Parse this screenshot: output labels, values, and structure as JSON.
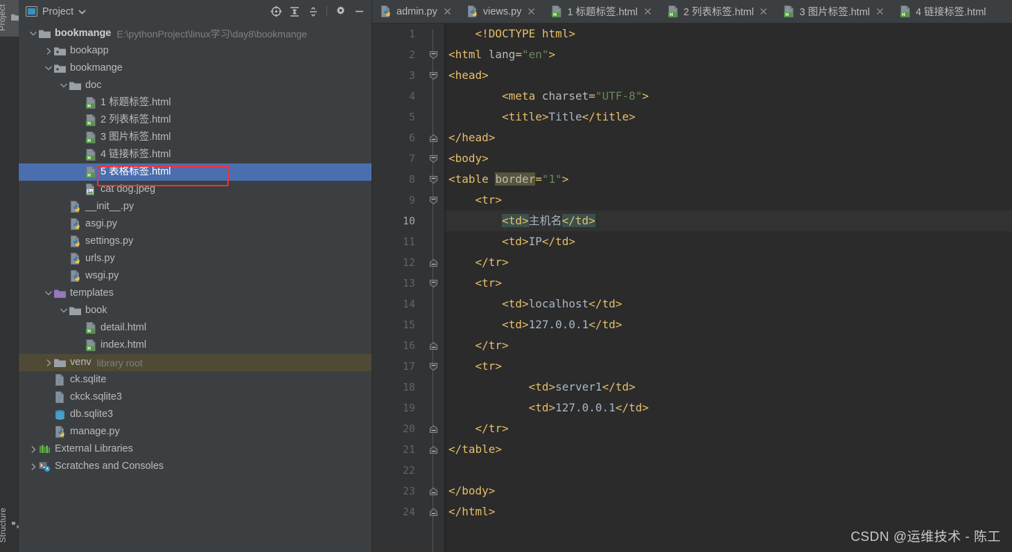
{
  "rail": {
    "top": {
      "label": "Project",
      "icon": "folder-icon",
      "active": true
    },
    "bottom": {
      "label": "Structure",
      "icon": "structure-icon",
      "active": false
    }
  },
  "project_panel": {
    "title": "Project",
    "dropdown_icon": "chevron-down-icon",
    "toolbar": [
      {
        "name": "select-opened-file-icon",
        "tooltip": "Select Opened File"
      },
      {
        "name": "expand-all-icon",
        "tooltip": "Expand All"
      },
      {
        "name": "collapse-all-icon",
        "tooltip": "Collapse All"
      },
      {
        "name": "settings-gear-icon",
        "tooltip": "Settings"
      },
      {
        "name": "hide-icon",
        "tooltip": "Hide"
      }
    ],
    "tree": [
      {
        "indent": 0,
        "arrow": "down",
        "icon": "folder-icon",
        "label": "bookmange",
        "bold": true,
        "path": "E:\\pythonProject\\linux学习\\day8\\bookmange",
        "state": "normal"
      },
      {
        "indent": 1,
        "arrow": "right",
        "icon": "module-folder-icon",
        "label": "bookapp",
        "bold": false,
        "state": "normal"
      },
      {
        "indent": 1,
        "arrow": "down",
        "icon": "module-folder-icon",
        "label": "bookmange",
        "bold": false,
        "state": "normal"
      },
      {
        "indent": 2,
        "arrow": "down",
        "icon": "folder-icon",
        "label": "doc",
        "bold": false,
        "state": "normal"
      },
      {
        "indent": 3,
        "arrow": "none",
        "icon": "html-file-icon",
        "label": "1 标题标签.html",
        "bold": false,
        "state": "normal"
      },
      {
        "indent": 3,
        "arrow": "none",
        "icon": "html-file-icon",
        "label": "2 列表标签.html",
        "bold": false,
        "state": "normal"
      },
      {
        "indent": 3,
        "arrow": "none",
        "icon": "html-file-icon",
        "label": "3 图片标签.html",
        "bold": false,
        "state": "normal"
      },
      {
        "indent": 3,
        "arrow": "none",
        "icon": "html-file-icon",
        "label": "4 链接标签.html",
        "bold": false,
        "state": "normal"
      },
      {
        "indent": 3,
        "arrow": "none",
        "icon": "html-file-icon",
        "label": "5 表格标签.html",
        "bold": false,
        "state": "selected"
      },
      {
        "indent": 3,
        "arrow": "none",
        "icon": "image-file-icon",
        "label": "cat dog.jpeg",
        "bold": false,
        "state": "normal"
      },
      {
        "indent": 2,
        "arrow": "none",
        "icon": "python-file-icon",
        "label": "__init__.py",
        "bold": false,
        "state": "normal"
      },
      {
        "indent": 2,
        "arrow": "none",
        "icon": "python-file-icon",
        "label": "asgi.py",
        "bold": false,
        "state": "normal"
      },
      {
        "indent": 2,
        "arrow": "none",
        "icon": "python-file-icon",
        "label": "settings.py",
        "bold": false,
        "state": "normal"
      },
      {
        "indent": 2,
        "arrow": "none",
        "icon": "python-file-icon",
        "label": "urls.py",
        "bold": false,
        "state": "normal"
      },
      {
        "indent": 2,
        "arrow": "none",
        "icon": "python-file-icon",
        "label": "wsgi.py",
        "bold": false,
        "state": "normal"
      },
      {
        "indent": 1,
        "arrow": "down",
        "icon": "templates-folder-icon",
        "label": "templates",
        "bold": false,
        "state": "normal"
      },
      {
        "indent": 2,
        "arrow": "down",
        "icon": "folder-icon",
        "label": "book",
        "bold": false,
        "state": "normal"
      },
      {
        "indent": 3,
        "arrow": "none",
        "icon": "html-file-icon",
        "label": "detail.html",
        "bold": false,
        "state": "normal"
      },
      {
        "indent": 3,
        "arrow": "none",
        "icon": "html-file-icon",
        "label": "index.html",
        "bold": false,
        "state": "normal"
      },
      {
        "indent": 1,
        "arrow": "right",
        "icon": "folder-icon",
        "label": "venv",
        "bold": false,
        "hint": "library root",
        "state": "hover"
      },
      {
        "indent": 1,
        "arrow": "none",
        "icon": "unknown-file-icon",
        "label": "ck.sqlite",
        "bold": false,
        "state": "normal"
      },
      {
        "indent": 1,
        "arrow": "none",
        "icon": "unknown-file-icon",
        "label": "ckck.sqlite3",
        "bold": false,
        "state": "normal"
      },
      {
        "indent": 1,
        "arrow": "none",
        "icon": "database-icon",
        "label": "db.sqlite3",
        "bold": false,
        "state": "normal"
      },
      {
        "indent": 1,
        "arrow": "none",
        "icon": "python-file-icon",
        "label": "manage.py",
        "bold": false,
        "state": "normal"
      },
      {
        "indent": 0,
        "arrow": "right",
        "icon": "external-libraries-icon",
        "label": "External Libraries",
        "bold": false,
        "state": "normal"
      },
      {
        "indent": 0,
        "arrow": "right",
        "icon": "scratches-icon",
        "label": "Scratches and Consoles",
        "bold": false,
        "state": "normal"
      }
    ]
  },
  "editor": {
    "tabs": [
      {
        "label": "admin.py",
        "icon": "python-file-icon",
        "closable": true,
        "active": false
      },
      {
        "label": "views.py",
        "icon": "python-file-icon",
        "closable": true,
        "active": false
      },
      {
        "label": "1 标题标签.html",
        "icon": "html-file-icon",
        "closable": true,
        "active": false
      },
      {
        "label": "2 列表标签.html",
        "icon": "html-file-icon",
        "closable": true,
        "active": false
      },
      {
        "label": "3 图片标签.html",
        "icon": "html-file-icon",
        "closable": true,
        "active": false
      },
      {
        "label": "4 链接标签.html",
        "icon": "html-file-icon",
        "closable": false,
        "active": false
      }
    ],
    "current_line": 10,
    "lines": [
      {
        "n": 1,
        "fold": "none",
        "indent": 1,
        "tokens": [
          {
            "t": "tag",
            "v": "<!DOCTYPE html>"
          }
        ]
      },
      {
        "n": 2,
        "fold": "open",
        "indent": 0,
        "tokens": [
          {
            "t": "tag",
            "v": "<html "
          },
          {
            "t": "attrname",
            "v": "lang"
          },
          {
            "t": "tag",
            "v": "="
          },
          {
            "t": "str",
            "v": "\"en\""
          },
          {
            "t": "tag",
            "v": ">"
          }
        ]
      },
      {
        "n": 3,
        "fold": "open",
        "indent": 0,
        "tokens": [
          {
            "t": "tag",
            "v": "<head>"
          }
        ]
      },
      {
        "n": 4,
        "fold": "none",
        "indent": 2,
        "tokens": [
          {
            "t": "tag",
            "v": "<meta "
          },
          {
            "t": "attrname",
            "v": "charset"
          },
          {
            "t": "tag",
            "v": "="
          },
          {
            "t": "str",
            "v": "\"UTF-8\""
          },
          {
            "t": "tag",
            "v": ">"
          }
        ]
      },
      {
        "n": 5,
        "fold": "none",
        "indent": 2,
        "tokens": [
          {
            "t": "tag",
            "v": "<title>"
          },
          {
            "t": "txt",
            "v": "Title"
          },
          {
            "t": "tag",
            "v": "</title>"
          }
        ]
      },
      {
        "n": 6,
        "fold": "close",
        "indent": 0,
        "tokens": [
          {
            "t": "tag",
            "v": "</head>"
          }
        ]
      },
      {
        "n": 7,
        "fold": "open",
        "indent": 0,
        "tokens": [
          {
            "t": "tag",
            "v": "<body>"
          }
        ]
      },
      {
        "n": 8,
        "fold": "open",
        "indent": 0,
        "tokens": [
          {
            "t": "tag",
            "v": "<table "
          },
          {
            "t": "attrname-hl",
            "v": "border"
          },
          {
            "t": "tag",
            "v": "="
          },
          {
            "t": "str",
            "v": "\"1\""
          },
          {
            "t": "tag",
            "v": ">"
          }
        ]
      },
      {
        "n": 9,
        "fold": "open",
        "indent": 1,
        "tokens": [
          {
            "t": "tag",
            "v": "<tr>"
          }
        ]
      },
      {
        "n": 10,
        "fold": "none",
        "indent": 2,
        "tokens": [
          {
            "t": "tag-hl",
            "v": "<td>"
          },
          {
            "t": "txt",
            "v": "主机名"
          },
          {
            "t": "tag-hl",
            "v": "</td>"
          }
        ]
      },
      {
        "n": 11,
        "fold": "none",
        "indent": 2,
        "tokens": [
          {
            "t": "tag",
            "v": "<td>"
          },
          {
            "t": "txt",
            "v": "IP"
          },
          {
            "t": "tag",
            "v": "</td>"
          }
        ]
      },
      {
        "n": 12,
        "fold": "close",
        "indent": 1,
        "tokens": [
          {
            "t": "tag",
            "v": "</tr>"
          }
        ]
      },
      {
        "n": 13,
        "fold": "open",
        "indent": 1,
        "tokens": [
          {
            "t": "tag",
            "v": "<tr>"
          }
        ]
      },
      {
        "n": 14,
        "fold": "none",
        "indent": 2,
        "tokens": [
          {
            "t": "tag",
            "v": "<td>"
          },
          {
            "t": "txt",
            "v": "localhost"
          },
          {
            "t": "tag",
            "v": "</td>"
          }
        ]
      },
      {
        "n": 15,
        "fold": "none",
        "indent": 2,
        "tokens": [
          {
            "t": "tag",
            "v": "<td>"
          },
          {
            "t": "txt",
            "v": "127.0.0.1"
          },
          {
            "t": "tag",
            "v": "</td>"
          }
        ]
      },
      {
        "n": 16,
        "fold": "close",
        "indent": 1,
        "tokens": [
          {
            "t": "tag",
            "v": "</tr>"
          }
        ]
      },
      {
        "n": 17,
        "fold": "open",
        "indent": 1,
        "tokens": [
          {
            "t": "tag",
            "v": "<tr>"
          }
        ]
      },
      {
        "n": 18,
        "fold": "none",
        "indent": 3,
        "tokens": [
          {
            "t": "tag",
            "v": "<td>"
          },
          {
            "t": "txt",
            "v": "server1"
          },
          {
            "t": "tag",
            "v": "</td>"
          }
        ]
      },
      {
        "n": 19,
        "fold": "none",
        "indent": 3,
        "tokens": [
          {
            "t": "tag",
            "v": "<td>"
          },
          {
            "t": "txt",
            "v": "127.0.0.1"
          },
          {
            "t": "tag",
            "v": "</td>"
          }
        ]
      },
      {
        "n": 20,
        "fold": "close",
        "indent": 1,
        "tokens": [
          {
            "t": "tag",
            "v": "</tr>"
          }
        ]
      },
      {
        "n": 21,
        "fold": "close",
        "indent": 0,
        "tokens": [
          {
            "t": "tag",
            "v": "</table>"
          }
        ]
      },
      {
        "n": 22,
        "fold": "none",
        "indent": 0,
        "tokens": []
      },
      {
        "n": 23,
        "fold": "close",
        "indent": 0,
        "tokens": [
          {
            "t": "tag",
            "v": "</body>"
          }
        ]
      },
      {
        "n": 24,
        "fold": "close",
        "indent": 0,
        "tokens": [
          {
            "t": "tag",
            "v": "</html>"
          }
        ]
      }
    ]
  },
  "watermark": "CSDN @运维技术 - 陈工",
  "colors": {
    "selection_blue": "#4b6eaf",
    "highlight_red": "#ff2d2d",
    "panel_bg": "#3c3f41",
    "editor_bg": "#2b2b2b",
    "tag_orange": "#e8bf6a",
    "string_green": "#6a8759",
    "text_blue": "#a9b7c6"
  }
}
